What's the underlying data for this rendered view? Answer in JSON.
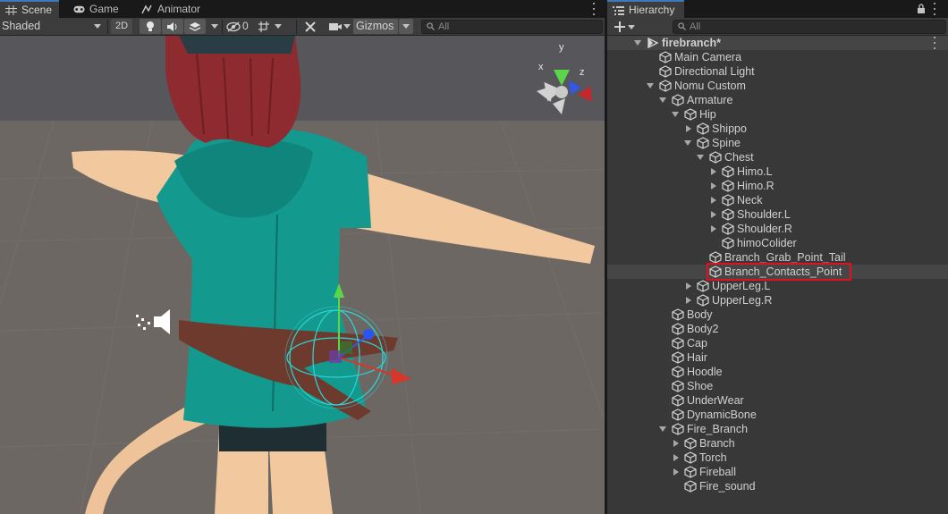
{
  "scene_panel": {
    "tabs": [
      {
        "label": "Scene",
        "icon": "grid-icon",
        "active": true
      },
      {
        "label": "Game",
        "icon": "gamepad-icon",
        "active": false
      },
      {
        "label": "Animator",
        "icon": "animator-icon",
        "active": false
      }
    ],
    "toolbar": {
      "draw_mode": "Shaded",
      "mode_2d": "2D",
      "hidden_count": "0",
      "gizmos": "Gizmos",
      "search_placeholder": "All"
    },
    "axis_labels": {
      "y": "y",
      "x": "x",
      "z": "z"
    }
  },
  "hierarchy": {
    "tab_label": "Hierarchy",
    "search_placeholder": "All",
    "highlight_color": "#e0121e",
    "selected_item": "Branch_Contacts_Point",
    "items": [
      {
        "label": "firebranch*",
        "depth": 0,
        "toggle": "expanded",
        "type": "scene"
      },
      {
        "label": "Main Camera",
        "depth": 1,
        "toggle": "none"
      },
      {
        "label": "Directional Light",
        "depth": 1,
        "toggle": "none"
      },
      {
        "label": "Nomu Custom",
        "depth": 1,
        "toggle": "expanded"
      },
      {
        "label": "Armature",
        "depth": 2,
        "toggle": "expanded"
      },
      {
        "label": "Hip",
        "depth": 3,
        "toggle": "expanded"
      },
      {
        "label": "Shippo",
        "depth": 4,
        "toggle": "collapsed"
      },
      {
        "label": "Spine",
        "depth": 4,
        "toggle": "expanded"
      },
      {
        "label": "Chest",
        "depth": 5,
        "toggle": "expanded"
      },
      {
        "label": "Himo.L",
        "depth": 6,
        "toggle": "collapsed"
      },
      {
        "label": "Himo.R",
        "depth": 6,
        "toggle": "collapsed"
      },
      {
        "label": "Neck",
        "depth": 6,
        "toggle": "collapsed"
      },
      {
        "label": "Shoulder.L",
        "depth": 6,
        "toggle": "collapsed"
      },
      {
        "label": "Shoulder.R",
        "depth": 6,
        "toggle": "collapsed"
      },
      {
        "label": "himoColider",
        "depth": 6,
        "toggle": "none"
      },
      {
        "label": "Branch_Grab_Point_Tail",
        "depth": 5,
        "toggle": "none"
      },
      {
        "label": "Branch_Contacts_Point",
        "depth": 5,
        "toggle": "none",
        "selected": true
      },
      {
        "label": "UpperLeg.L",
        "depth": 4,
        "toggle": "collapsed"
      },
      {
        "label": "UpperLeg.R",
        "depth": 4,
        "toggle": "collapsed"
      },
      {
        "label": "Body",
        "depth": 2,
        "toggle": "none"
      },
      {
        "label": "Body2",
        "depth": 2,
        "toggle": "none"
      },
      {
        "label": "Cap",
        "depth": 2,
        "toggle": "none"
      },
      {
        "label": "Hair",
        "depth": 2,
        "toggle": "none"
      },
      {
        "label": "Hoodle",
        "depth": 2,
        "toggle": "none"
      },
      {
        "label": "Shoe",
        "depth": 2,
        "toggle": "none"
      },
      {
        "label": "UnderWear",
        "depth": 2,
        "toggle": "none"
      },
      {
        "label": "DynamicBone",
        "depth": 2,
        "toggle": "none"
      },
      {
        "label": "Fire_Branch",
        "depth": 2,
        "toggle": "expanded"
      },
      {
        "label": "Branch",
        "depth": 3,
        "toggle": "collapsed"
      },
      {
        "label": "Torch",
        "depth": 3,
        "toggle": "collapsed"
      },
      {
        "label": "Fireball",
        "depth": 3,
        "toggle": "collapsed"
      },
      {
        "label": "Fire_sound",
        "depth": 3,
        "toggle": "none"
      }
    ]
  }
}
